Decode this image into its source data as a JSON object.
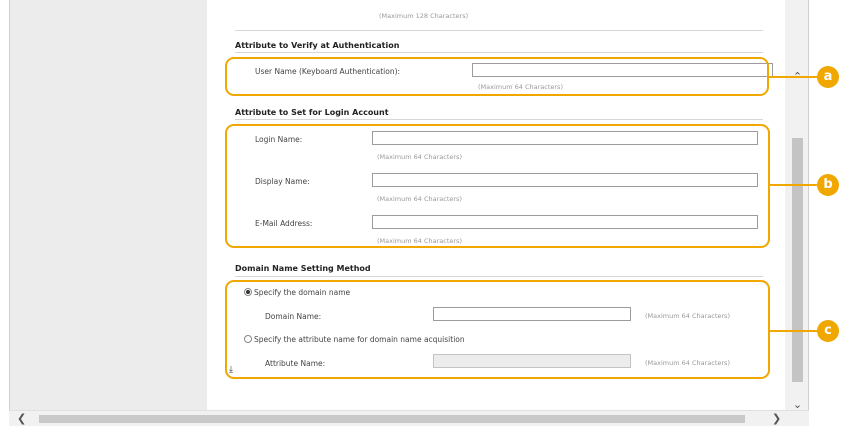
{
  "top_hint": "(Maximum 128 Characters)",
  "auth_section": {
    "title": "Attribute to Verify at Authentication",
    "username_label": "User Name (Keyboard Authentication):",
    "username_value": "",
    "username_hint": "(Maximum 64 Characters)"
  },
  "login_section": {
    "title": "Attribute to Set for Login Account",
    "fields": [
      {
        "label": "Login Name:",
        "value": "",
        "hint": "(Maximum 64 Characters)"
      },
      {
        "label": "Display Name:",
        "value": "",
        "hint": "(Maximum 64 Characters)"
      },
      {
        "label": "E-Mail Address:",
        "value": "",
        "hint": "(Maximum 64 Characters)"
      }
    ]
  },
  "domain_section": {
    "title": "Domain Name Setting Method",
    "option_specify": {
      "label": "Specify the domain name",
      "selected": true
    },
    "domain_name_label": "Domain Name:",
    "domain_name_value": "",
    "domain_name_hint": "(Maximum 64 Characters)",
    "option_attribute": {
      "label": "Specify the attribute name for domain name acquisition",
      "selected": false
    },
    "attribute_name_label": "Attribute Name:",
    "attribute_name_value": "",
    "attribute_name_hint": "(Maximum 64 Characters)"
  },
  "callouts": {
    "a": "a",
    "b": "b",
    "c": "c"
  },
  "icons": {
    "scroll_up": "chevron-up-icon",
    "scroll_down": "chevron-down-icon",
    "scroll_left": "chevron-left-icon",
    "scroll_right": "chevron-right-icon",
    "page_end": "scroll-to-bottom-icon"
  },
  "colors": {
    "callout": "#f0a800",
    "panel": "#ececec"
  }
}
